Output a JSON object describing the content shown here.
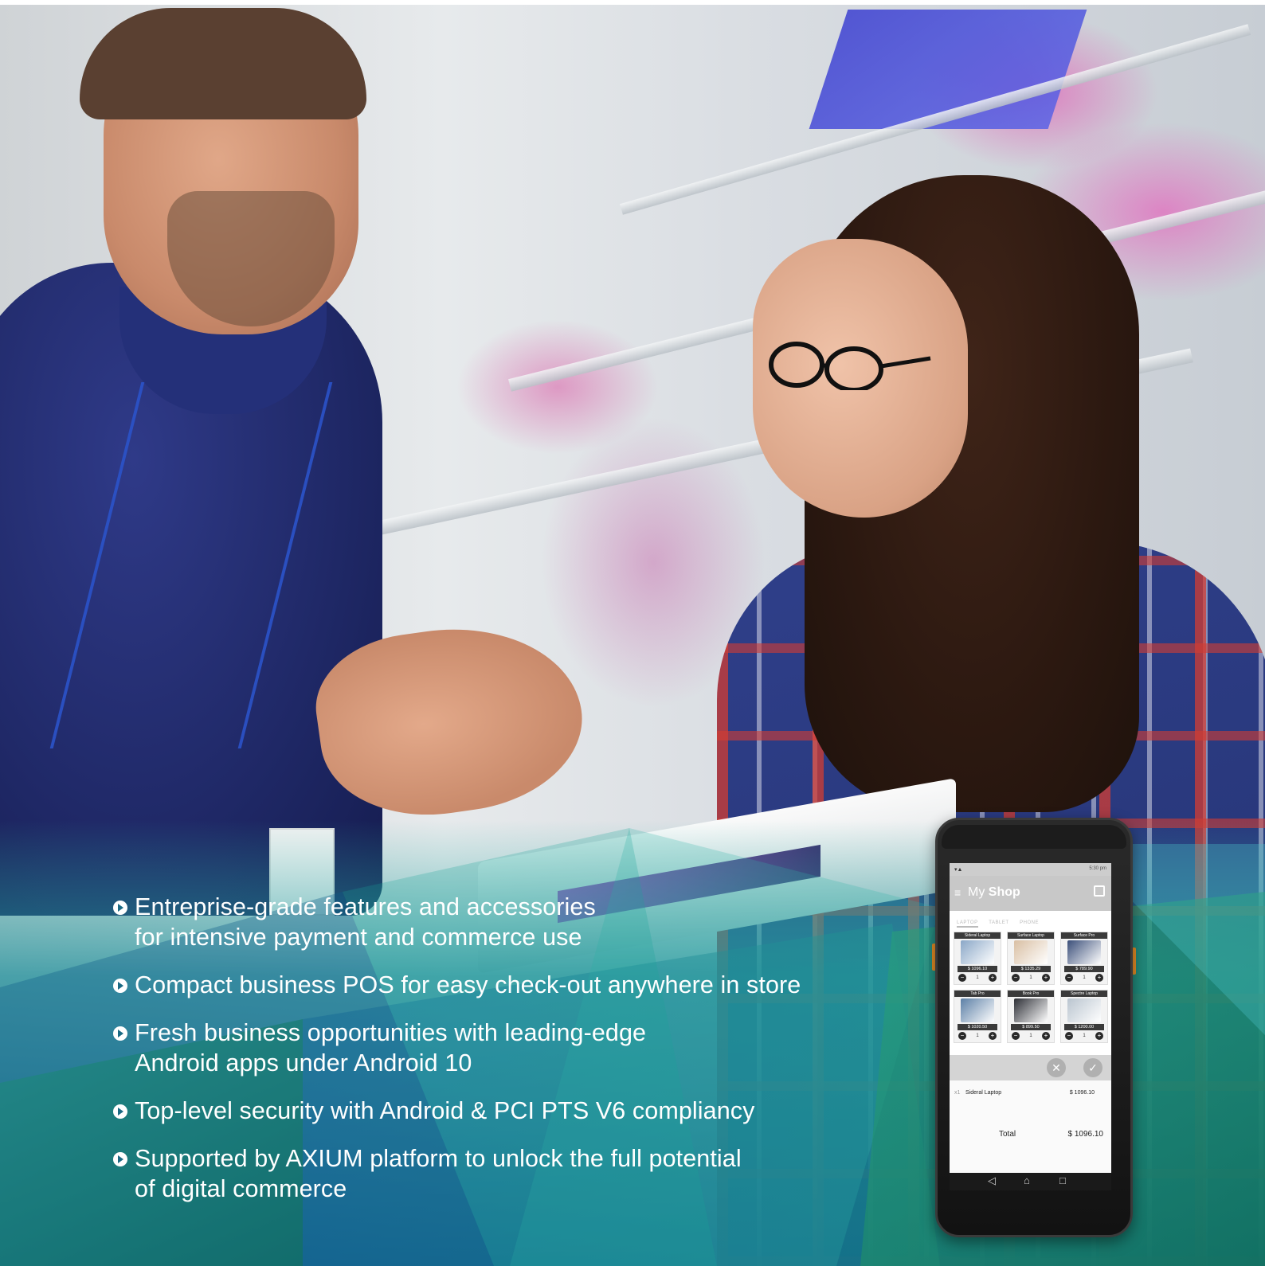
{
  "features": [
    {
      "lines": [
        "Entreprise-grade features and accessories",
        "for intensive payment and commerce use"
      ]
    },
    {
      "lines": [
        "Compact business POS for easy check-out anywhere in store"
      ]
    },
    {
      "lines": [
        "Fresh business opportunities with leading-edge",
        "Android apps under Android 10"
      ]
    },
    {
      "lines": [
        "Top-level security with Android & PCI PTS V6 compliancy"
      ]
    },
    {
      "lines": [
        "Supported by AXIUM platform to unlock the full potential",
        "of digital commerce"
      ]
    }
  ],
  "device": {
    "status_time": "5:30 pm",
    "app_title_my": "My",
    "app_title_shop": "Shop",
    "tabs": [
      "LAPTOP",
      "TABLET",
      "PHONE"
    ],
    "active_tab": "LAPTOP",
    "products": [
      {
        "name": "Sideral Laptop",
        "price": "$ 1096.10",
        "qty": "1",
        "color": "#8aa7c7"
      },
      {
        "name": "Surface Laptop",
        "price": "$ 1335.29",
        "qty": "1",
        "color": "#d9bfa3"
      },
      {
        "name": "Surface Pro",
        "price": "$ 789.90",
        "qty": "1",
        "color": "#3b4f7a"
      },
      {
        "name": "Tab Pro",
        "price": "$ 1020.50",
        "qty": "1",
        "color": "#5b7fa6"
      },
      {
        "name": "Book Pro",
        "price": "$ 899.50",
        "qty": "1",
        "color": "#2d2f36"
      },
      {
        "name": "Spectre Laptop",
        "price": "$ 1200.00",
        "qty": "1",
        "color": "#b9c4cf"
      }
    ],
    "cart": {
      "qty": "x1",
      "item": "Sideral Laptop",
      "amount": "$ 1096.10",
      "total_label": "Total",
      "total_value": "$ 1096.10"
    }
  },
  "colors": {
    "teal_dark": "#0e6b7a",
    "teal_light": "#2fb3a8",
    "green": "#1f9a63",
    "device_accent": "#e38b25"
  }
}
